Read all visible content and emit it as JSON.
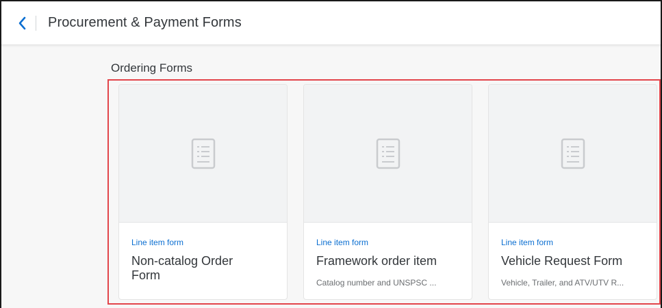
{
  "header": {
    "back_icon": "chevron-left-icon",
    "title": "Procurement & Payment Forms"
  },
  "section": {
    "title": "Ordering Forms"
  },
  "colors": {
    "accent": "#0a6ed1",
    "highlight_border": "#e2444a",
    "text": "#32363a",
    "muted": "#6a6d70"
  },
  "cards": [
    {
      "icon": "document-form-icon",
      "type": "Line item form",
      "title_line1": "Non-catalog Order",
      "title_line2": "Form",
      "description": ""
    },
    {
      "icon": "document-form-icon",
      "type": "Line item form",
      "title_line1": "Framework order item",
      "title_line2": "",
      "description": "Catalog number and UNSPSC ..."
    },
    {
      "icon": "document-form-icon",
      "type": "Line item form",
      "title_line1": "Vehicle Request Form",
      "title_line2": "",
      "description": "Vehicle, Trailer, and ATV/UTV R..."
    }
  ]
}
